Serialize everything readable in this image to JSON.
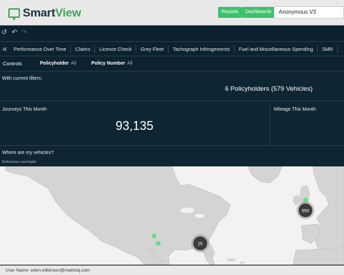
{
  "app": {
    "name_main": "Smart",
    "name_accent": "View"
  },
  "header": {
    "reports_label": "Reports",
    "dashboards_label": "Dashboards",
    "account_value": "Anonymous V3"
  },
  "toolbar": {
    "icons": [
      "undo-icon",
      "back-icon",
      "redo-icon"
    ]
  },
  "tabs": [
    "Performance Over Time",
    "Claims",
    "Licence Check",
    "Grey Fleet",
    "Tachograph Infringements",
    "Fuel and Miscellaneous Spending",
    "SMR"
  ],
  "controls": {
    "title": "Controls",
    "policyholder_label": "Policyholder",
    "policyholder_value": "All",
    "policy_number_label": "Policy Number",
    "policy_number_value": "All"
  },
  "filters": {
    "title": "With current filters:",
    "value": "6 Policyholders (579 Vehicles)"
  },
  "journeys": {
    "title": "Journeys This Month",
    "value": "93,135"
  },
  "mileage": {
    "title": "Mileage This Month"
  },
  "map": {
    "title": "Where are my vehicles?",
    "subtitle": "Refreshes overnight",
    "clusters": [
      {
        "label": "550"
      },
      {
        "label": "25"
      }
    ]
  },
  "status": {
    "user_text": "User Name: eden.wilkinson@matrixiq.com"
  },
  "colors": {
    "accent": "#3dc26a",
    "dark_bg": "#0d2230",
    "map_land": "#d4d4d4",
    "map_sea": "#f2f2f2"
  }
}
